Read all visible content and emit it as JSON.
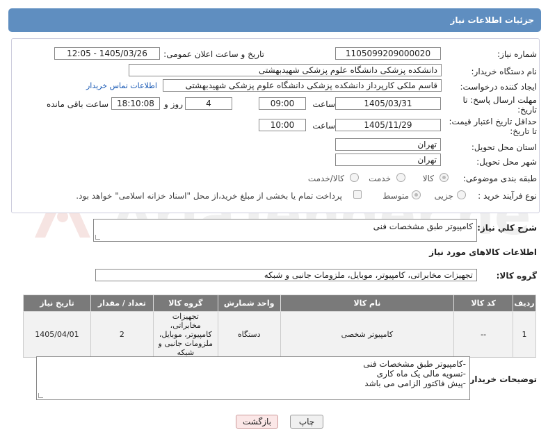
{
  "header": {
    "title": "جزئیات اطلاعات نیاز"
  },
  "form": {
    "need_number_label": "شماره نیاز:",
    "need_number": "1105099209000020",
    "announce_label": "تاریخ و ساعت اعلان عمومی:",
    "announce_value": "1405/03/26 - 12:05",
    "buyer_label": "نام دستگاه خریدار:",
    "buyer_value": "دانشکده پزشکی دانشگاه علوم پزشکی شهیدبهشتی",
    "creator_label": "ایجاد کننده درخواست:",
    "creator_value": "قاسم ملکی کارپرداز دانشکده پزشکی دانشگاه علوم پزشکی شهیدبهشتی",
    "contact_link": "اطلاعات تماس خریدار",
    "deadline_label_1": "مهلت ارسال پاسخ: تا",
    "deadline_label_2": "تاریخ:",
    "deadline_date": "1405/03/31",
    "time_label": "ساعت",
    "deadline_time": "09:00",
    "days_value": "4",
    "days_label": "روز و",
    "remaining_time": "18:10:08",
    "remaining_label": "ساعت باقی مانده",
    "validity_label_1": "حداقل تاریخ اعتبار قیمت:",
    "validity_label_2": "تا تاریخ:",
    "validity_date": "1405/11/29",
    "validity_time": "10:00",
    "province_label": "استان محل تحویل:",
    "province_value": "تهران",
    "city_label": "شهر محل تحویل:",
    "city_value": "تهران",
    "category_label": "طبقه بندی موضوعی:",
    "category_options": [
      "کالا",
      "خدمت",
      "کالا/خدمت"
    ],
    "process_label": "نوع فرآیند خرید :",
    "process_options": [
      "جزیی",
      "متوسط"
    ],
    "payment_note": "پرداخت تمام یا بخشی از مبلغ خرید،از محل \"اسناد خزانه اسلامی\" خواهد بود."
  },
  "description": {
    "label": "شرح کلي نياز:",
    "value": "کامپیوتر طبق مشخصات فنی"
  },
  "goods_section": {
    "title": "اطلاعات کالاهای مورد نیاز",
    "group_label": "گروه کالا:",
    "group_value": "تجهیزات مخابراتی، کامپیوتر، موبایل، ملزومات جانبی و شبکه"
  },
  "table": {
    "headers": [
      "ردیف",
      "کد کالا",
      "نام کالا",
      "واحد شمارش",
      "گروه کالا",
      "تعداد / مقدار",
      "تاریخ نیاز"
    ],
    "rows": [
      [
        "1",
        "--",
        "کامپیوتر شخصی",
        "دستگاه",
        "تجهیزات مخابراتی، کامپیوتر، موبایل، ملزومات جانبی و شبکه",
        "2",
        "1405/04/01"
      ]
    ]
  },
  "buyer_notes": {
    "label": "توضیحات خریدار:",
    "line1": "-کامپیوتر طبق مشخصات فنی",
    "line2": "-تسویه مالی یک ماه کاری",
    "line3": "-پیش فاکتور الزامی می باشد"
  },
  "buttons": {
    "print": "چاپ",
    "back": "بازگشت"
  },
  "watermark": {
    "text": "AriaTender.net"
  },
  "colors": {
    "header": "#5f8ec0",
    "table_header": "#7a7a7a",
    "link": "#1a5ab5"
  }
}
